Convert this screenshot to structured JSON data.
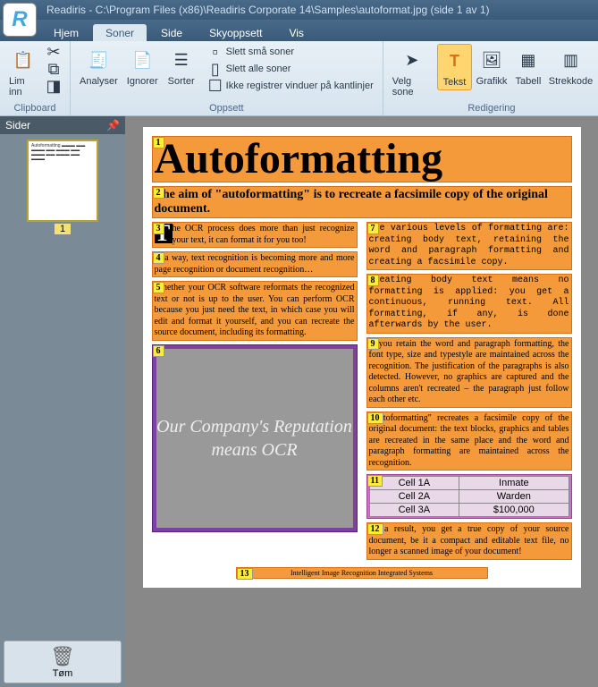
{
  "title": "Readiris - C:\\Program Files (x86)\\Readiris Corporate 14\\Samples\\autoformat.jpg (side 1 av 1)",
  "app_icon_letter": "R",
  "tabs": {
    "hjem": "Hjem",
    "soner": "Soner",
    "side": "Side",
    "skyoppsett": "Skyoppsett",
    "vis": "Vis"
  },
  "ribbon": {
    "clipboard": {
      "label": "Clipboard",
      "lim_inn": "Lim inn"
    },
    "oppsett": {
      "label": "Oppsett",
      "analyser": "Analyser",
      "ignorer": "Ignorer",
      "sorter": "Sorter",
      "slett_sma": "Slett små soner",
      "slett_alle": "Slett alle soner",
      "ikke_registrer": "Ikke registrer vinduer på kantlinjer"
    },
    "redigering": {
      "label": "Redigering",
      "velg_sone": "Velg sone",
      "tekst": "Tekst",
      "grafikk": "Grafikk",
      "tabell": "Tabell",
      "strekkode": "Strekkode"
    }
  },
  "sidepanel": {
    "title": "Sider",
    "page_num": "1",
    "tom": "Tøm"
  },
  "doc": {
    "z1": "Autoformatting",
    "z2": "The aim of \"autoformatting\" is to recreate a facsimile copy of the original document.",
    "z3_drop": "T",
    "z3": "he OCR process does more than just recognize your text, it can format it for you too!",
    "z4": "In a way, text recognition is becoming more and more page recognition or document recognition…",
    "z5": "Whether your OCR software reformats the recognized text or not is up to the user. You can perform OCR because you just need the text, in which case you will edit and format it yourself, and you can recreate the source document, including its formatting.",
    "z6": "Our Company's Reputation means OCR",
    "z7": "The various levels of formatting are: creating body text, retaining the word and paragraph formatting and creating a facsimile copy.",
    "z8": "Creating body text means no formatting is applied: you get a continuous, running text. All formatting, if any, is done afterwards by the user.",
    "z9": "If you retain the word and paragraph formatting, the font type, size and typestyle are maintained across the recognition. The justification of the paragraphs is also detected. However, no graphics are captured and the columns aren't recreated – the paragraph just follow each other etc.",
    "z10": "\"Autoformatting\" recreates a facsimile copy of the original document: the text blocks, graphics and tables are recreated in the same place and the word and paragraph formatting are maintained across the recognition.",
    "z11": {
      "r1c1": "Cell 1A",
      "r1c2": "Inmate",
      "r2c1": "Cell 2A",
      "r2c2": "Warden",
      "r3c1": "Cell 3A",
      "r3c2": "$100,000"
    },
    "z12": "As a result, you get a true copy of your source document, be it a compact and editable text file, no longer a scanned image of your document!",
    "z13": "Intelligent Image Recognition Integrated Systems",
    "nums": {
      "1": "1",
      "2": "2",
      "3": "3",
      "4": "4",
      "5": "5",
      "6": "6",
      "7": "7",
      "8": "8",
      "9": "9",
      "10": "10",
      "11": "11",
      "12": "12",
      "13": "13"
    }
  }
}
